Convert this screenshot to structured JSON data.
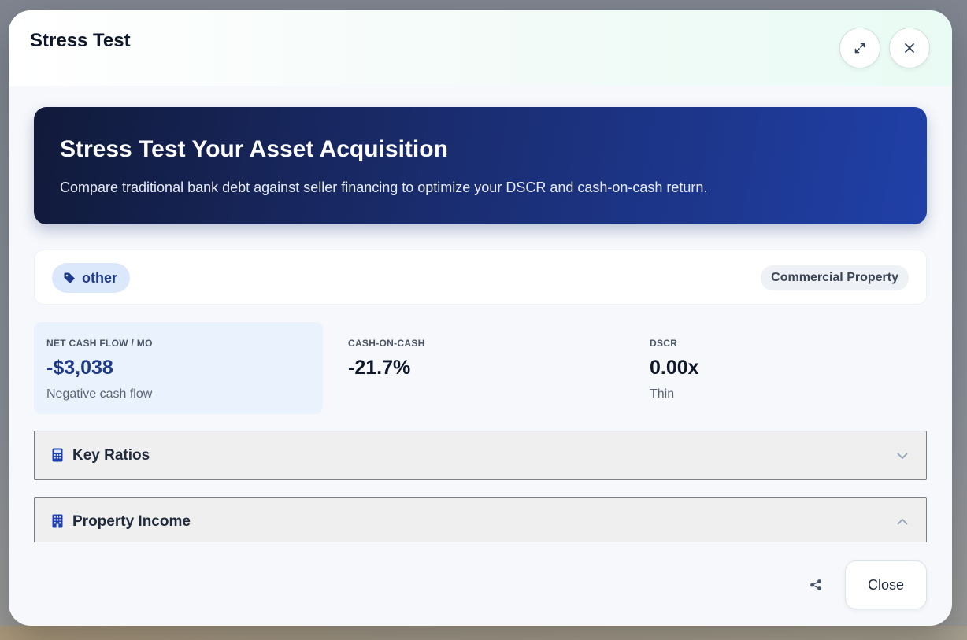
{
  "modal": {
    "title": "Stress Test",
    "expand_icon": "expand-arrows-icon",
    "close_icon": "close-x-icon"
  },
  "hero": {
    "title": "Stress Test Your Asset Acquisition",
    "subtitle": "Compare traditional bank debt against seller financing to optimize your DSCR and cash-on-cash return."
  },
  "tags": {
    "category_label": "other",
    "category_icon": "tag-icon",
    "property_type": "Commercial Property"
  },
  "metrics": [
    {
      "label": "NET CASH FLOW / MO",
      "value": "-$3,038",
      "note": "Negative cash flow"
    },
    {
      "label": "CASH-ON-CASH",
      "value": "-21.7%",
      "note": ""
    },
    {
      "label": "DSCR",
      "value": "0.00x",
      "note": "Thin"
    }
  ],
  "sections": [
    {
      "title": "Key Ratios",
      "icon": "calculator-icon",
      "state": "collapsed"
    },
    {
      "title": "Property Income",
      "icon": "building-icon",
      "state": "expanded"
    }
  ],
  "footer": {
    "share_icon": "share-icon",
    "close_label": "Close"
  },
  "colors": {
    "accent": "#1e3a8a",
    "hero_start": "#111a3a",
    "hero_end": "#2040a8",
    "metric_highlight_bg": "#eaf2fd"
  }
}
